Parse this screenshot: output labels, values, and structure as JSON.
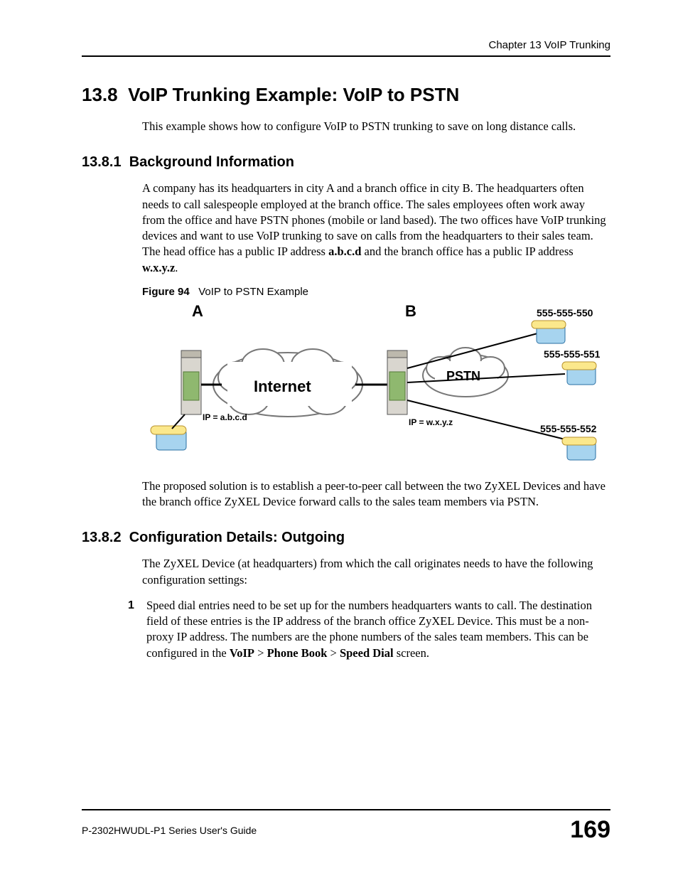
{
  "header": {
    "chapter_ref": "Chapter 13 VoIP Trunking"
  },
  "section": {
    "number": "13.8",
    "title": "VoIP Trunking Example: VoIP to PSTN",
    "intro": "This example shows how to configure VoIP to PSTN trunking to save on long distance calls."
  },
  "sub1": {
    "number": "13.8.1",
    "title": "Background Information",
    "para1_pre": "A company has its headquarters in city A and a branch office in city B. The headquarters often needs to call salespeople employed at the branch office. The sales employees often work away from the office and have PSTN phones (mobile or land based). The two offices have VoIP trunking devices and want to use VoIP trunking to save on calls from the headquarters to their sales team. The head office has a public IP address ",
    "ip1": "a.b.c.d",
    "para1_mid": " and the branch office has a public IP address ",
    "ip2": "w.x.y.z",
    "para1_post": ".",
    "figure": {
      "label": "Figure 94",
      "caption": "VoIP to PSTN Example",
      "node_a": "A",
      "node_b": "B",
      "cloud_internet": "Internet",
      "cloud_pstn": "PSTN",
      "ip_a": "IP = a.b.c.d",
      "ip_b": "IP = w.x.y.z",
      "phone1": "555-555-550",
      "phone2": "555-555-551",
      "phone3": "555-555-552"
    },
    "para2": "The proposed solution is to establish a peer-to-peer call between the two ZyXEL Devices and have the branch office ZyXEL Device forward calls to the sales team members via PSTN."
  },
  "sub2": {
    "number": "13.8.2",
    "title": "Configuration Details: Outgoing",
    "intro": "The ZyXEL Device (at headquarters) from which the call originates needs to have the following configuration settings:",
    "item1_num": "1",
    "item1_pre": "Speed dial entries need to be set up for the numbers headquarters wants to call. The destination field of these entries is the IP address of the branch office ZyXEL Device. This must be a non-proxy IP address. The numbers are the phone numbers of the sales team members. This can be configured in the ",
    "nav1": "VoIP",
    "gt": ">",
    "nav2": "Phone Book",
    "nav3": "Speed Dial",
    "item1_post": " screen."
  },
  "footer": {
    "guide": "P-2302HWUDL-P1 Series User's Guide",
    "page": "169"
  }
}
